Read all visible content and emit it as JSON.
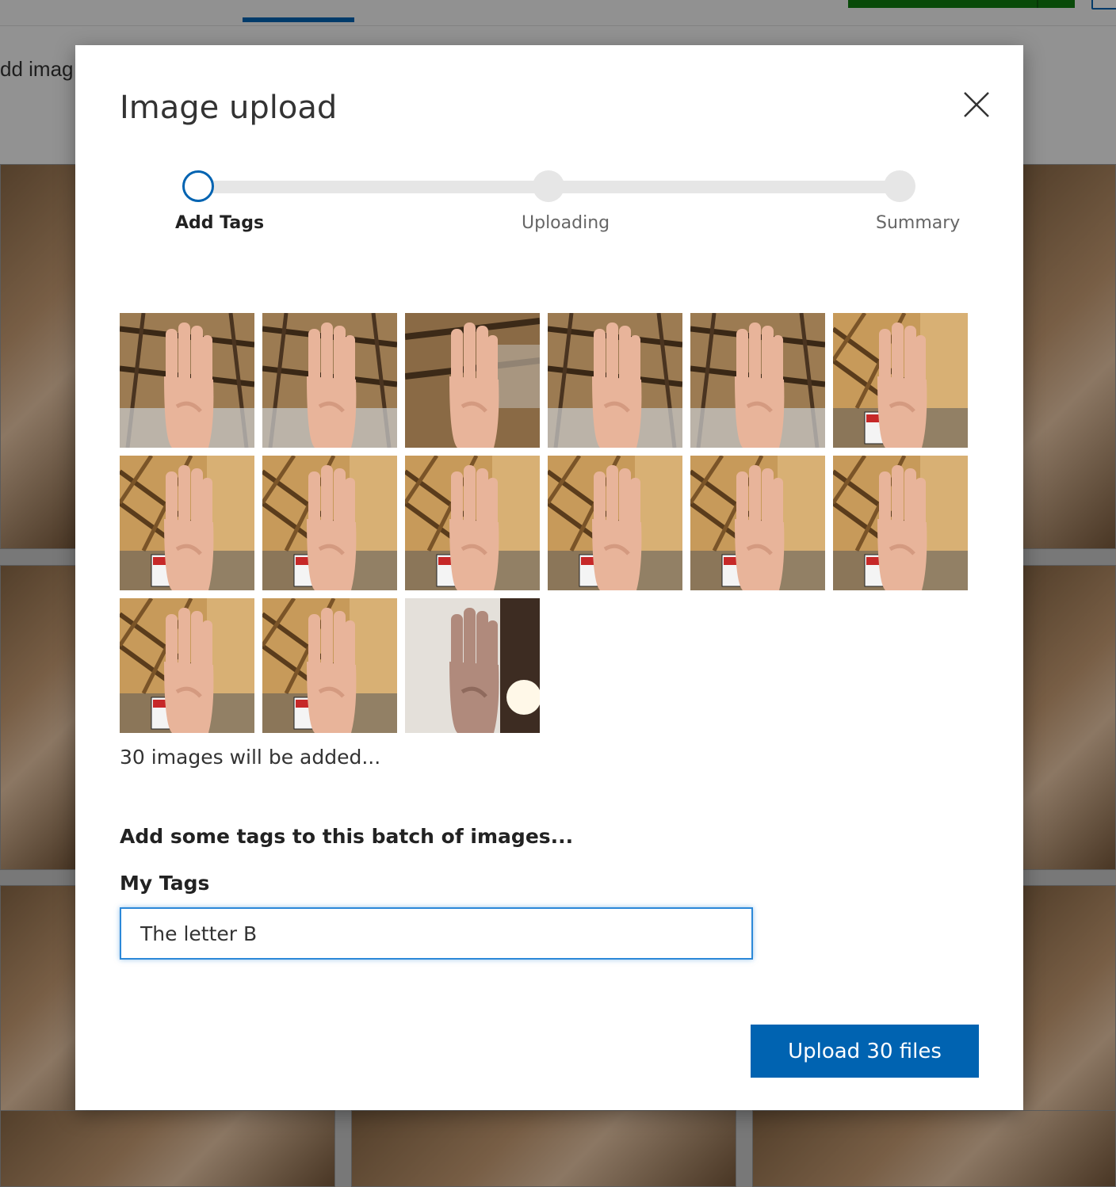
{
  "background": {
    "toolbar_label": "dd imag"
  },
  "dialog": {
    "title": "Image upload",
    "close_icon": "close-icon"
  },
  "stepper": {
    "steps": [
      {
        "label": "Add Tags",
        "state": "active"
      },
      {
        "label": "Uploading",
        "state": "pending"
      },
      {
        "label": "Summary",
        "state": "pending"
      }
    ]
  },
  "thumbnails": {
    "visible_count": 15,
    "variants": [
      "hand-bright",
      "hand-bright",
      "hand-blur",
      "hand-bright",
      "hand-bright",
      "hand-site",
      "hand-site",
      "hand-site",
      "hand-site",
      "hand-site",
      "hand-site",
      "hand-site",
      "hand-site",
      "hand-site",
      "hand-indoor"
    ]
  },
  "status": {
    "count_text": "30 images will be added..."
  },
  "tags": {
    "heading": "Add some tags to this batch of images...",
    "label": "My Tags",
    "value": "The letter B"
  },
  "actions": {
    "upload_label": "Upload 30 files"
  },
  "colors": {
    "accent": "#0063b1",
    "step_pending": "#e6e6e6",
    "focus_border": "#2b88d8"
  }
}
